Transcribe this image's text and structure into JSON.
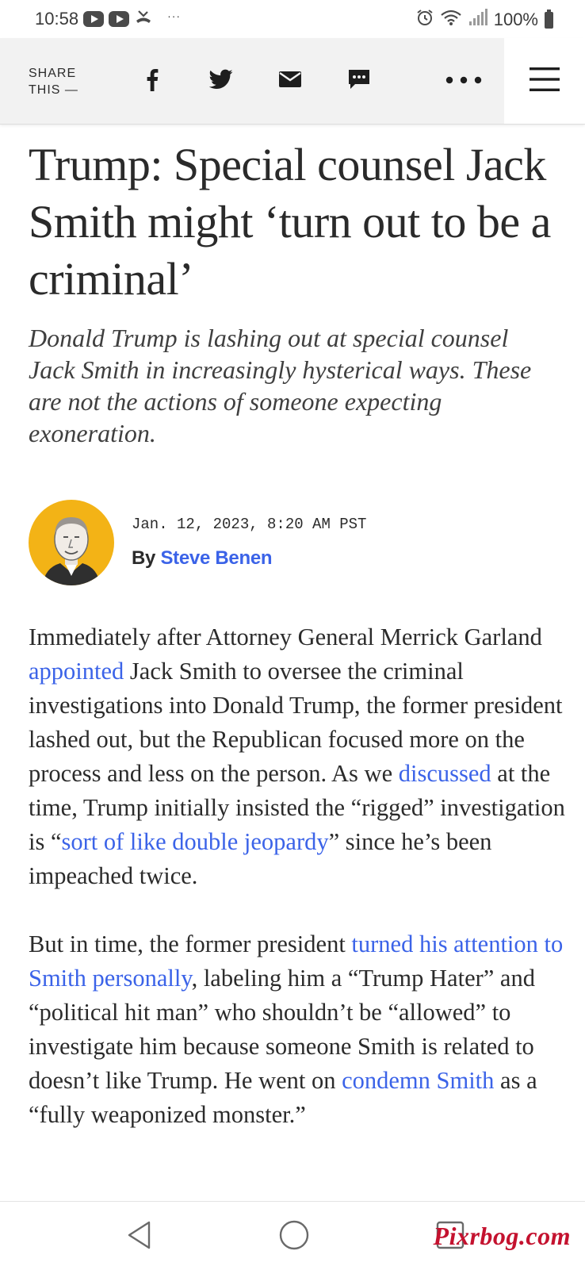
{
  "status_bar": {
    "time": "10:58",
    "extra_dots": "···",
    "battery_percent": "100%",
    "icons": [
      "youtube-icon",
      "youtube-icon",
      "missed-call-icon",
      "alarm-icon",
      "wifi-icon",
      "signal-icon",
      "battery-icon"
    ]
  },
  "share_bar": {
    "label_line1": "SHARE",
    "label_line2": "THIS —",
    "icons": [
      "facebook-icon",
      "twitter-icon",
      "email-icon",
      "sms-icon",
      "more-icon",
      "menu-icon"
    ]
  },
  "article": {
    "headline": "Trump: Special counsel Jack Smith might ‘turn out to be a criminal’",
    "dek": "Donald Trump is lashing out at special counsel Jack Smith in increasingly hysterical ways. These are not the actions of someone expecting exoneration.",
    "timestamp": "Jan. 12, 2023, 8:20 AM PST",
    "by_prefix": "By",
    "author": "Steve Benen",
    "p1": {
      "t1": "Immediately after Attorney General Merrick Garland ",
      "l1": "appointed",
      "t2": " Jack Smith to oversee the criminal investigations into Donald Trump, the former president lashed out, but the Republican focused more on the process and less on the person. As we ",
      "l2": "discussed",
      "t3": " at the time, Trump initially insisted the “rigged” investigation is “",
      "l3": "sort of like double jeopardy",
      "t4": "” since he’s been impeached twice."
    },
    "p2": {
      "t1": "But in time, the former president ",
      "l1": "turned his attention to Smith personally",
      "t2": ", labeling him a “Trump Hater” and “political hit man” who shouldn’t be “allowed” to investigate him because someone Smith is related to doesn’t like Trump. He went on ",
      "l2": "condemn Smith",
      "t3": " as a “fully weaponized monster.”"
    }
  },
  "nav_bar": {
    "icons": [
      "back-icon",
      "home-icon",
      "recents-icon"
    ]
  },
  "watermark": "Pixrbog.com",
  "colors": {
    "link": "#3b63e8",
    "avatar_bg": "#f3b316",
    "share_bar_bg": "#f2f2f2",
    "watermark": "#c4122f"
  }
}
